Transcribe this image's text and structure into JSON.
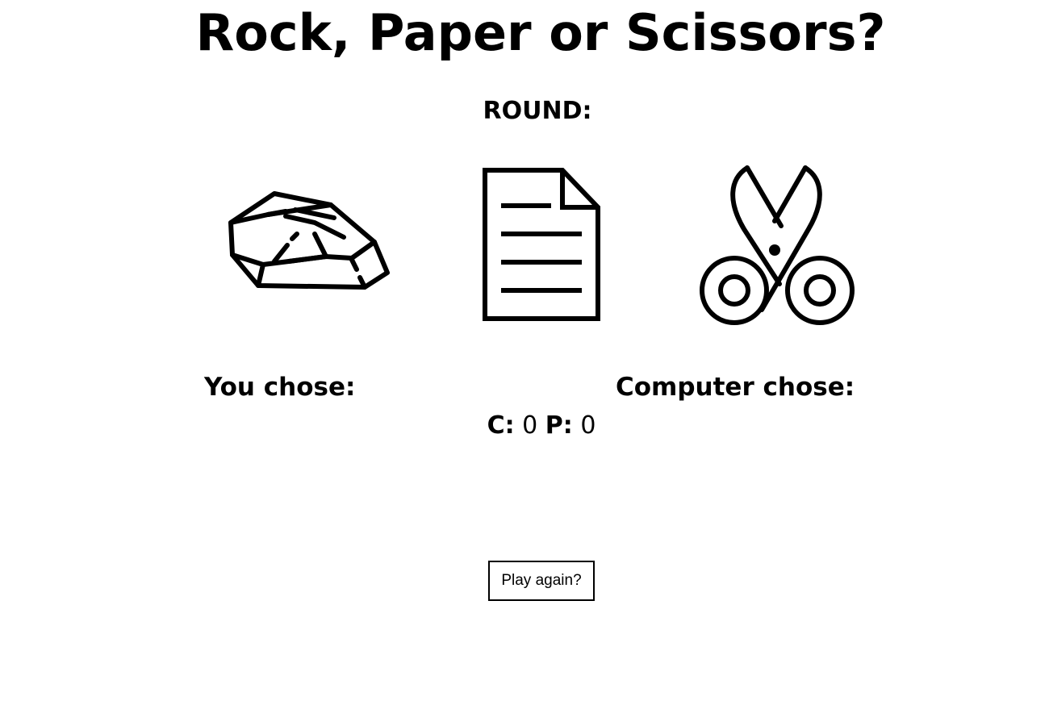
{
  "title": "Rock, Paper or Scissors?",
  "round": {
    "label": "ROUND:",
    "value": ""
  },
  "choices": [
    {
      "id": "rock",
      "icon": "rock-icon"
    },
    {
      "id": "paper",
      "icon": "paper-document-icon"
    },
    {
      "id": "scissors",
      "icon": "scissors-icon"
    }
  ],
  "player": {
    "label": "You chose:",
    "choice": ""
  },
  "computer": {
    "label": "Computer chose:",
    "choice": ""
  },
  "score": {
    "computer_label": "C:",
    "computer_value": "0",
    "player_label": "P:",
    "player_value": "0"
  },
  "play_again_label": "Play again?",
  "colors": {
    "ink": "#000000",
    "background": "#ffffff"
  }
}
